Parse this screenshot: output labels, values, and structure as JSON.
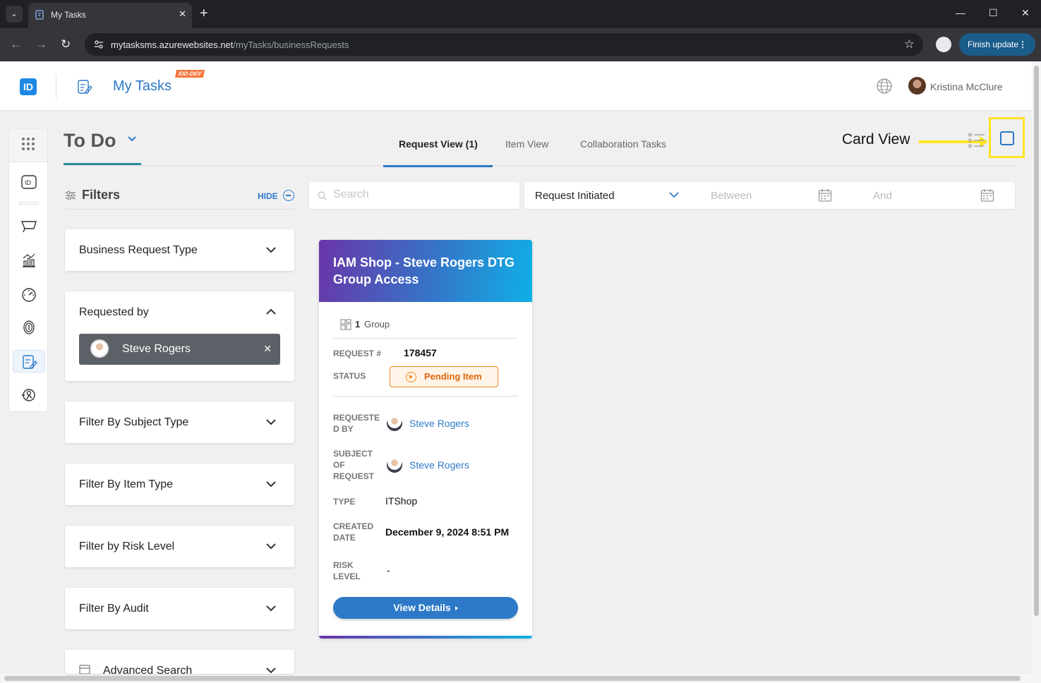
{
  "browser": {
    "tab_title": "My Tasks",
    "url_host": "mytasksms.azurewebsites.net",
    "url_path": "/myTasks/businessRequests",
    "finish_update": "Finish update"
  },
  "header": {
    "app_title": "My Tasks",
    "env_badge": "EID-DEV",
    "user_name": "Kristina McClure"
  },
  "page": {
    "section_title": "To Do",
    "tabs": [
      "Request View (1)",
      "Item View",
      "Collaboration Tasks"
    ],
    "card_view_label": "Card View"
  },
  "filters": {
    "title": "Filters",
    "hide_label": "HIDE",
    "items": [
      "Business Request Type",
      "Requested by",
      "Filter By Subject Type",
      "Filter By Item Type",
      "Filter by Risk Level",
      "Filter By Audit",
      "Advanced Search"
    ],
    "requested_by_chip": "Steve Rogers"
  },
  "search": {
    "placeholder": "Search",
    "date_field": "Request Initiated",
    "between_placeholder": "Between",
    "and_placeholder": "And"
  },
  "request_card": {
    "title": "IAM Shop - Steve Rogers DTG Group Access",
    "group_count": "1",
    "group_label": "Group",
    "request_label": "REQUEST #",
    "request_number": "178457",
    "status_label": "STATUS",
    "status_value": "Pending Item",
    "requested_by_label": "REQUESTE D BY",
    "requested_by": "Steve Rogers",
    "subject_label": "SUBJECT OF REQUEST",
    "subject": "Steve Rogers",
    "type_label": "TYPE",
    "type_value": "ITShop",
    "created_label": "CREATED DATE",
    "created_value": "December 9, 2024 8:51 PM",
    "risk_label": "RISK LEVEL",
    "risk_value": "-",
    "view_details": "View Details"
  },
  "colors": {
    "accent": "#2d79c7",
    "status_orange": "#f08a24",
    "highlight_yellow": "#ffe224"
  }
}
